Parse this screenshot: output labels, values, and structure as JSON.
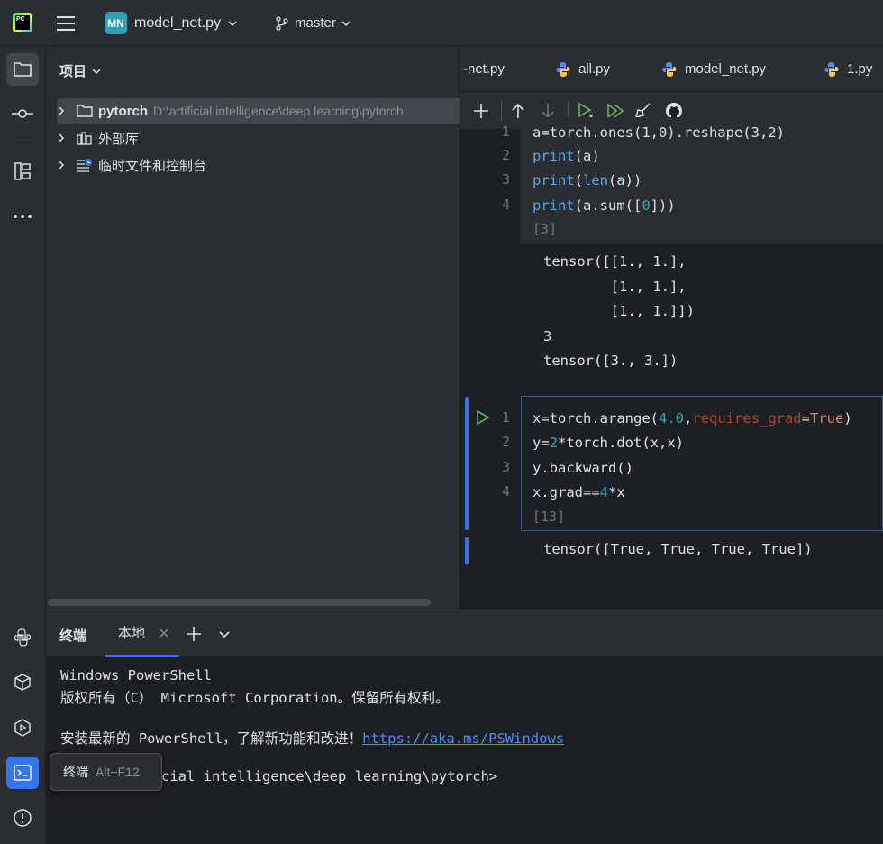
{
  "titlebar": {
    "project_badge": "MN",
    "project_name": "model_net.py",
    "branch": "master"
  },
  "project_panel": {
    "title": "项目",
    "tree": [
      {
        "label": "pytorch",
        "path": "D:\\artificial intelligence\\deep learning\\pytorch"
      },
      {
        "label": "外部库"
      },
      {
        "label": "临时文件和控制台"
      }
    ]
  },
  "editor": {
    "tabs": [
      "-net.py",
      "all.py",
      "model_net.py",
      "1.py"
    ],
    "cell1": {
      "top_partial": "a=torch.ones(1,0).reshape(3,2)",
      "line_numbers": [
        "1",
        "2",
        "3",
        "4"
      ],
      "lines": [
        "print(a)",
        "print(len(a))",
        "print(a.sum([0]))"
      ],
      "exec_count": "[3]",
      "output": [
        "tensor([[1., 1.],",
        "        [1., 1.],",
        "        [1., 1.]])",
        "3",
        "tensor([3., 3.])"
      ]
    },
    "cell2": {
      "line_numbers": [
        "1",
        "2",
        "3",
        "4"
      ],
      "lines": [
        "x=torch.arange(4.0,requires_grad=True)",
        "y=2*torch.dot(x,x)",
        "y.backward()",
        "x.grad==4*x"
      ],
      "exec_count": "[13]",
      "output": [
        "tensor([True, True, True, True])"
      ]
    }
  },
  "terminal": {
    "title": "终端",
    "tab_label": "本地",
    "lines": [
      "Windows PowerShell",
      "版权所有（C） Microsoft Corporation。保留所有权利。",
      "",
      "安装最新的 PowerShell，了解新功能和改进！"
    ],
    "link": "https://aka.ms/PSWindows",
    "prompt": "PS D:\\artificial intelligence\\deep learning\\pytorch>"
  },
  "tooltip": {
    "label": "终端",
    "shortcut": "Alt+F12"
  }
}
